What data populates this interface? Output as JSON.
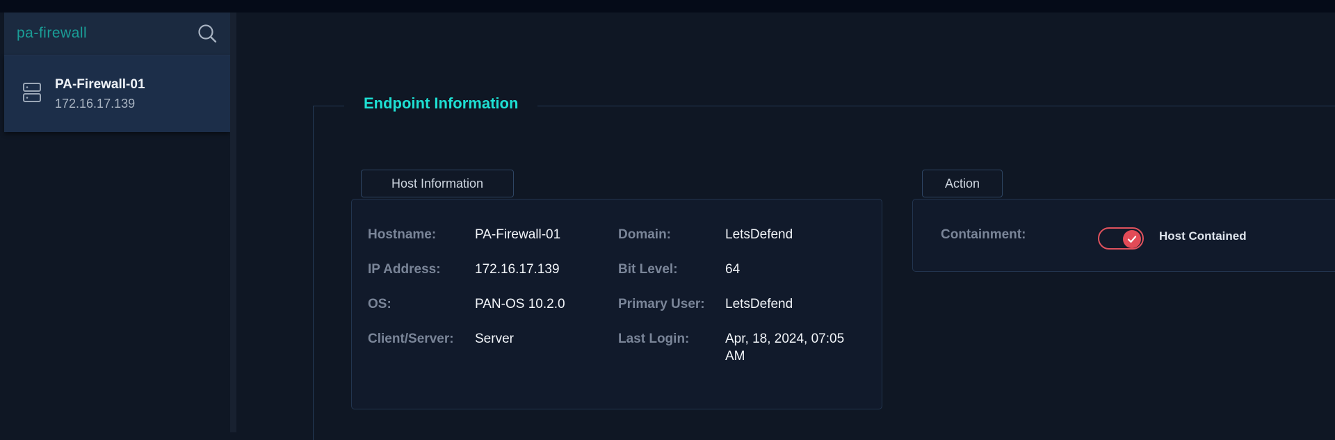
{
  "search": {
    "value": "pa-firewall"
  },
  "sidebar": {
    "devices": [
      {
        "name": "PA-Firewall-01",
        "ip": "172.16.17.139"
      }
    ]
  },
  "main": {
    "section_title": "Endpoint Information",
    "host_tab": "Host Information",
    "action_tab": "Action",
    "host_info": {
      "hostname_label": "Hostname:",
      "hostname": "PA-Firewall-01",
      "ip_label": "IP Address:",
      "ip": "172.16.17.139",
      "os_label": "OS:",
      "os": "PAN-OS 10.2.0",
      "client_label": "Client/Server:",
      "client": "Server",
      "domain_label": "Domain:",
      "domain": "LetsDefend",
      "bit_label": "Bit Level:",
      "bit": "64",
      "user_label": "Primary User:",
      "user": "LetsDefend",
      "login_label": "Last Login:",
      "login": "Apr, 18, 2024, 07:05 AM"
    },
    "action": {
      "containment_label": "Containment:",
      "containment_on": true,
      "containment_status": "Host Contained"
    }
  },
  "colors": {
    "accent": "#1ee0d3",
    "toggle": "#e24b57",
    "background": "#0f1724"
  },
  "icons": {
    "search": "search-icon",
    "device": "server-icon",
    "toggle": "check-icon"
  }
}
